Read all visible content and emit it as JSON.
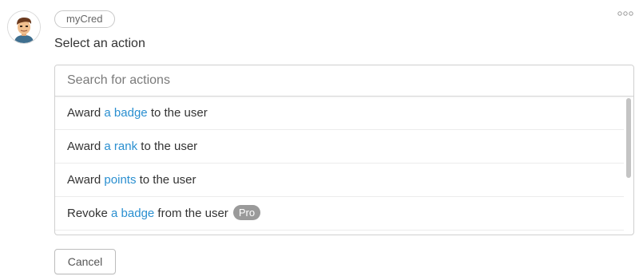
{
  "app": {
    "source_badge": "myCred",
    "title": "Select an action",
    "more_icon": "more-horizontal-icon",
    "avatar_icon": "user-avatar-icon"
  },
  "search": {
    "placeholder": "Search for actions",
    "value": ""
  },
  "actions": [
    {
      "prefix": "Award ",
      "highlight": "a badge",
      "suffix": " to the user",
      "badge": ""
    },
    {
      "prefix": "Award ",
      "highlight": "a rank",
      "suffix": " to the user",
      "badge": ""
    },
    {
      "prefix": "Award ",
      "highlight": "points",
      "suffix": " to the user",
      "badge": ""
    },
    {
      "prefix": "Revoke ",
      "highlight": "a badge",
      "suffix": " from the user",
      "badge": "Pro"
    }
  ],
  "buttons": {
    "cancel_label": "Cancel"
  },
  "colors": {
    "highlight": "#2a8fd0",
    "pro_badge": "#9a9a9a",
    "border": "#cfcfcf"
  }
}
